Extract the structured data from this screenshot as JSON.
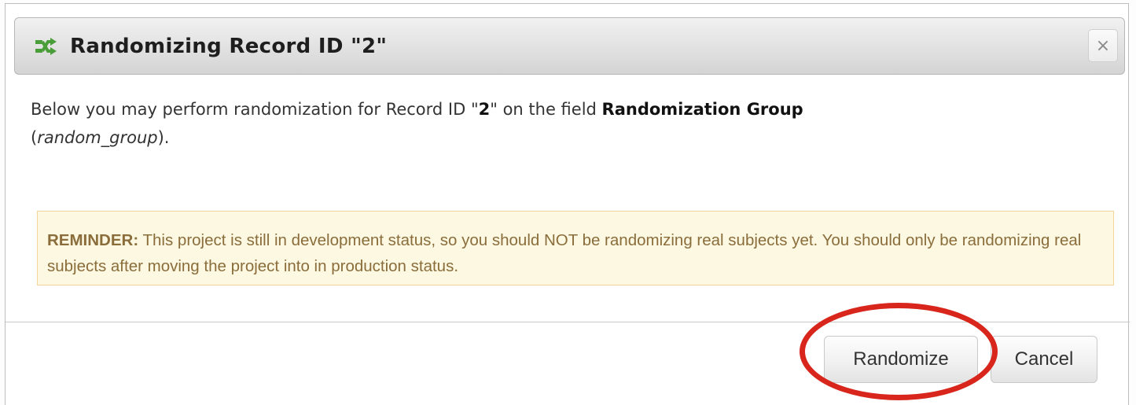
{
  "dialog": {
    "title": "Randomizing Record ID \"2\"",
    "title_icon": "shuffle-icon",
    "close_icon": "close-icon",
    "close_glyph": "×"
  },
  "intro": {
    "text_before_record": "Below you may perform randomization for Record ID \"",
    "record_id": "2",
    "text_after_record": "\" on the field ",
    "field_label": "Randomization Group",
    "paren_open": "(",
    "field_variable": "random_group",
    "paren_close": ")."
  },
  "reminder": {
    "label": "REMINDER:",
    "text": " This project is still in development status, so you should NOT be randomizing real subjects yet. You should only be randomizing real subjects after moving the project into in production status."
  },
  "buttons": {
    "randomize_label": "Randomize",
    "cancel_label": "Cancel"
  },
  "colors": {
    "highlight_ring": "#d8261c",
    "reminder_bg": "#fcf8e2",
    "reminder_border": "#f4d599",
    "reminder_text": "#8a6d3b",
    "icon_green": "#4a9e3a"
  }
}
